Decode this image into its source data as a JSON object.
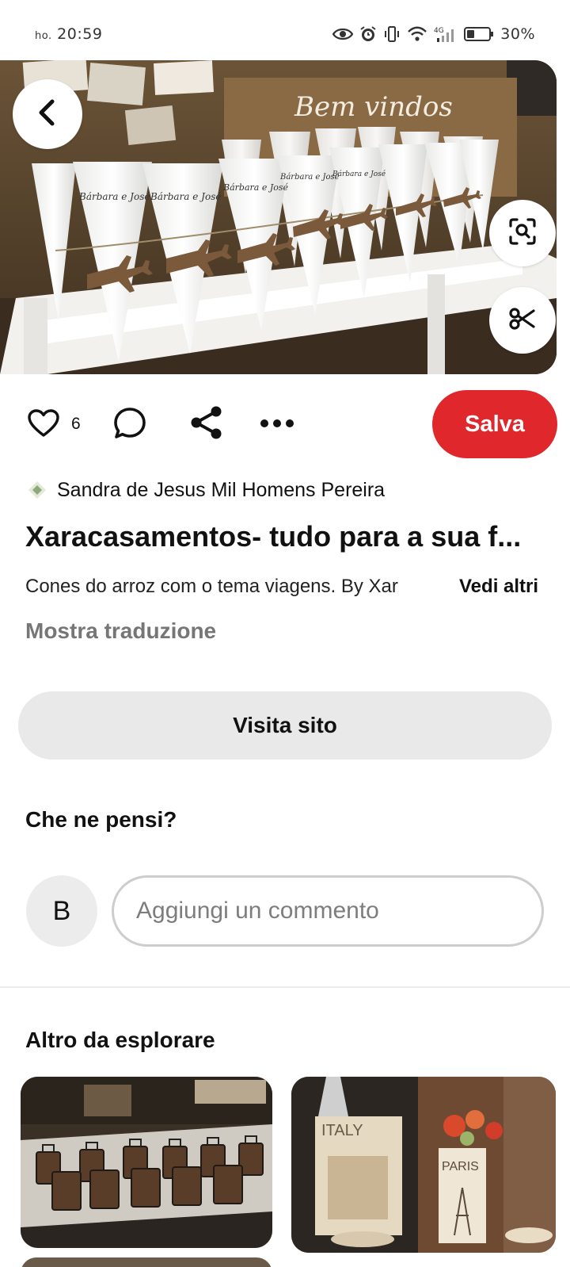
{
  "status_bar": {
    "carrier": "ho.",
    "time": "20:59",
    "battery": "30%",
    "icons": [
      "eye-icon",
      "alarm-icon",
      "vibrate-icon",
      "wifi-icon",
      "signal-4g-icon",
      "battery-icon"
    ]
  },
  "hero": {
    "image_sign_text": "Bem vindos",
    "cone_label": "Bárbara e José",
    "buttons": [
      "back-arrow-icon",
      "visual-search-icon",
      "scissors-icon"
    ]
  },
  "actions": {
    "like_count": "6",
    "save_label": "Salva",
    "icons": [
      "heart-icon",
      "comment-icon",
      "share-icon",
      "more-icon"
    ]
  },
  "pin": {
    "author": "Sandra de Jesus Mil Homens Pereira",
    "title": "Xaracasamentos- tudo para a sua f...",
    "description": "Cones do arroz com o tema viagens. By Xar",
    "see_more": "Vedi altri",
    "translate": "Mostra traduzione"
  },
  "visit_button": "Visita sito",
  "comments": {
    "title": "Che ne pensi?",
    "avatar_initial": "B",
    "placeholder": "Aggiungi un commento"
  },
  "explore": {
    "title": "Altro da esplorare",
    "thumb_2_labels": [
      "ITALY",
      "PARIS"
    ]
  },
  "colors": {
    "save_red": "#e0272c",
    "visit_gray": "#e9e9e9",
    "muted_text": "#767676"
  }
}
